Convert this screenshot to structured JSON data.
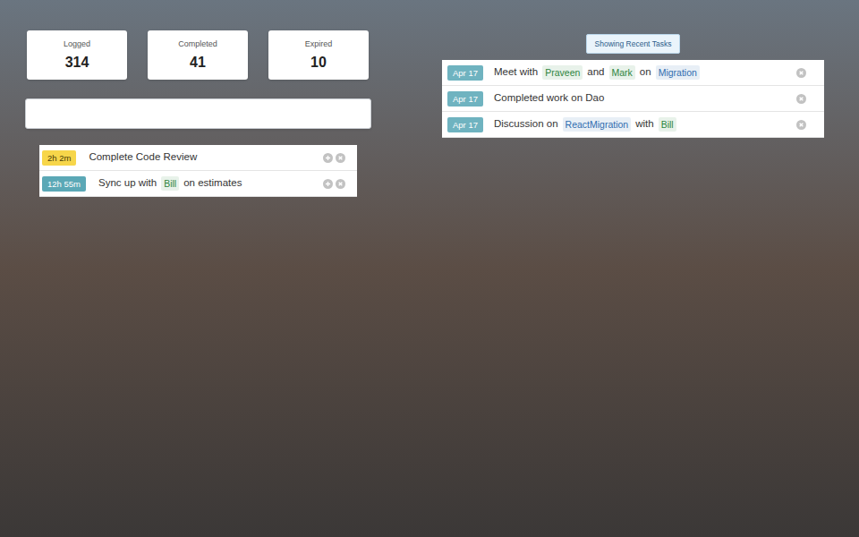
{
  "stats": [
    {
      "label": "Logged",
      "value": "314"
    },
    {
      "label": "Completed",
      "value": "41"
    },
    {
      "label": "Expired",
      "value": "10"
    }
  ],
  "entry": {
    "value": ""
  },
  "timed_tasks": [
    {
      "time": "2h 2m",
      "color": "#f7d64a",
      "parts": [
        {
          "kind": "text",
          "text": "Complete Code Review"
        }
      ]
    },
    {
      "time": "12h 55m",
      "color": "#5ba8b6",
      "parts": [
        {
          "kind": "text",
          "text": "Sync up with"
        },
        {
          "kind": "tag",
          "text": "Bill",
          "color": "#2e8540"
        },
        {
          "kind": "text",
          "text": "on estimates"
        }
      ]
    }
  ],
  "recent_toggle": {
    "label": "Showing Recent Tasks"
  },
  "recent_tasks": [
    {
      "date": "Apr 17",
      "color": "#6fb3c0",
      "parts": [
        {
          "kind": "text",
          "text": "Meet with"
        },
        {
          "kind": "tag",
          "text": "Praveen",
          "color": "#2e8540"
        },
        {
          "kind": "text",
          "text": "and"
        },
        {
          "kind": "tag",
          "text": "Mark",
          "color": "#2e8540"
        },
        {
          "kind": "text",
          "text": "on"
        },
        {
          "kind": "tag",
          "text": "Migration",
          "color": "#2f6db0"
        }
      ]
    },
    {
      "date": "Apr 17",
      "color": "#6fb3c0",
      "parts": [
        {
          "kind": "text",
          "text": "Completed work on Dao"
        }
      ]
    },
    {
      "date": "Apr 17",
      "color": "#6fb3c0",
      "parts": [
        {
          "kind": "text",
          "text": "Discussion on"
        },
        {
          "kind": "tag",
          "text": "ReactMigration",
          "color": "#2f6db0"
        },
        {
          "kind": "text",
          "text": "with"
        },
        {
          "kind": "tag",
          "text": "Bill",
          "color": "#2e8540"
        }
      ]
    }
  ]
}
